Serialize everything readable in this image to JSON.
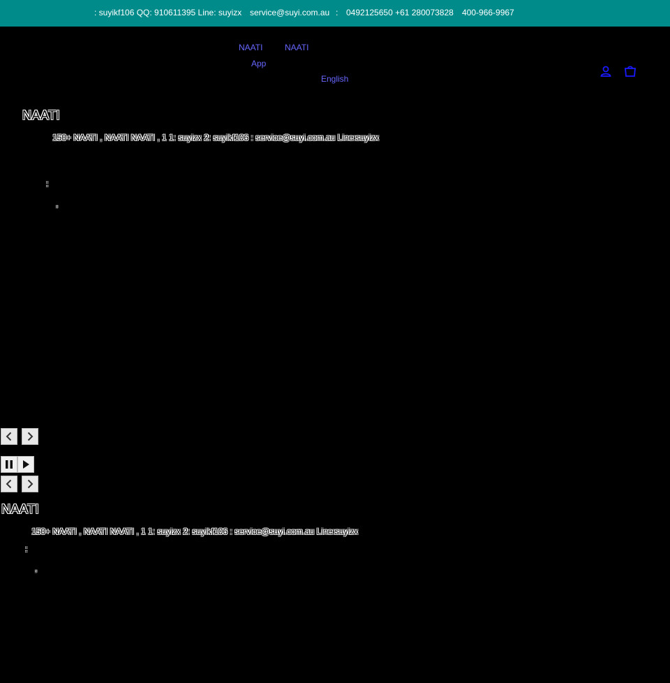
{
  "topbar": {
    "wechat": ": suyikf106 QQ: 910611395 Line: suyizx",
    "email": "service@suyi.com.au",
    "colon": ":",
    "phones": "0492125650 +61 280073828",
    "hotline": "400-966-9967"
  },
  "nav": {
    "link_1": "NAATI",
    "link_2": "NAATI",
    "app": "App",
    "language": "English"
  },
  "header_icons": {
    "account": "account-icon",
    "cart": "cart-icon"
  },
  "slide_1": {
    "title": "NAATI",
    "description": "150+ NAATI   ,  NAATI     NAATI                      ,  1            1: suyizx  2: suyikf106  : service@suyi.com.au  Line:suyizx",
    "line_a": ":",
    "line_b": ","
  },
  "controls": {
    "prev": "chevron-left-icon",
    "next": "chevron-right-icon",
    "pause": "pause-icon",
    "play": "play-icon"
  },
  "slide_2": {
    "title": "NAATI",
    "description": "150+ NAATI   ,  NAATI     NAATI                      ,  1            1: suyizx  2: suyikf106  : service@suyi.com.au  Line:suyizx",
    "line_a": ":",
    "line_b": ","
  }
}
